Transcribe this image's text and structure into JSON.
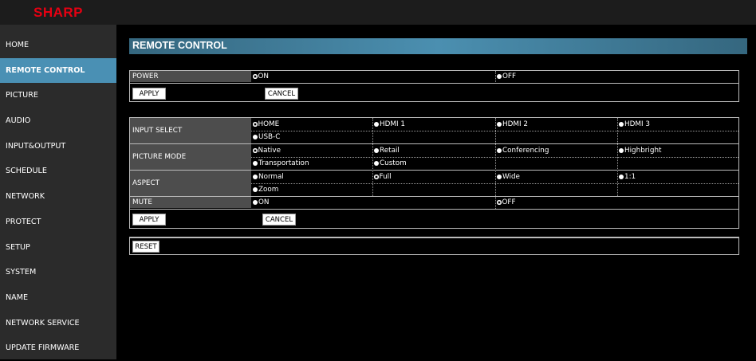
{
  "brand": "SHARP",
  "sidebar": {
    "items": [
      {
        "label": "HOME"
      },
      {
        "label": "REMOTE CONTROL",
        "active": true
      },
      {
        "label": "PICTURE"
      },
      {
        "label": "AUDIO"
      },
      {
        "label": "INPUT&OUTPUT"
      },
      {
        "label": "SCHEDULE"
      },
      {
        "label": "NETWORK"
      },
      {
        "label": "PROTECT"
      },
      {
        "label": "SETUP"
      },
      {
        "label": "SYSTEM"
      },
      {
        "label": "NAME"
      },
      {
        "label": "NETWORK SERVICE"
      },
      {
        "label": "UPDATE FIRMWARE"
      }
    ]
  },
  "page_title": "REMOTE CONTROL",
  "power": {
    "label": "POWER",
    "options": [
      "ON",
      "OFF"
    ],
    "selected": "ON",
    "apply": "APPLY",
    "cancel": "CANCEL"
  },
  "input_select": {
    "label": "INPUT SELECT",
    "options": [
      "HOME",
      "HDMI 1",
      "HDMI 2",
      "HDMI 3",
      "USB-C"
    ],
    "selected": "HOME"
  },
  "picture_mode": {
    "label": "PICTURE MODE",
    "options": [
      "Native",
      "Retail",
      "Conferencing",
      "Highbright",
      "Transportation",
      "Custom"
    ],
    "selected": "Native"
  },
  "aspect": {
    "label": "ASPECT",
    "options": [
      "Normal",
      "Full",
      "Wide",
      "1:1",
      "Zoom"
    ],
    "selected": "Full"
  },
  "mute": {
    "label": "MUTE",
    "options": [
      "ON",
      "OFF"
    ],
    "selected": "OFF"
  },
  "apply2": "APPLY",
  "cancel2": "CANCEL",
  "reset": "RESET",
  "colors": {
    "accent": "#4a90b4",
    "brand": "#e60012",
    "sidebar_bg": "#2b2b2b",
    "label_bg": "#4d4d4d"
  }
}
